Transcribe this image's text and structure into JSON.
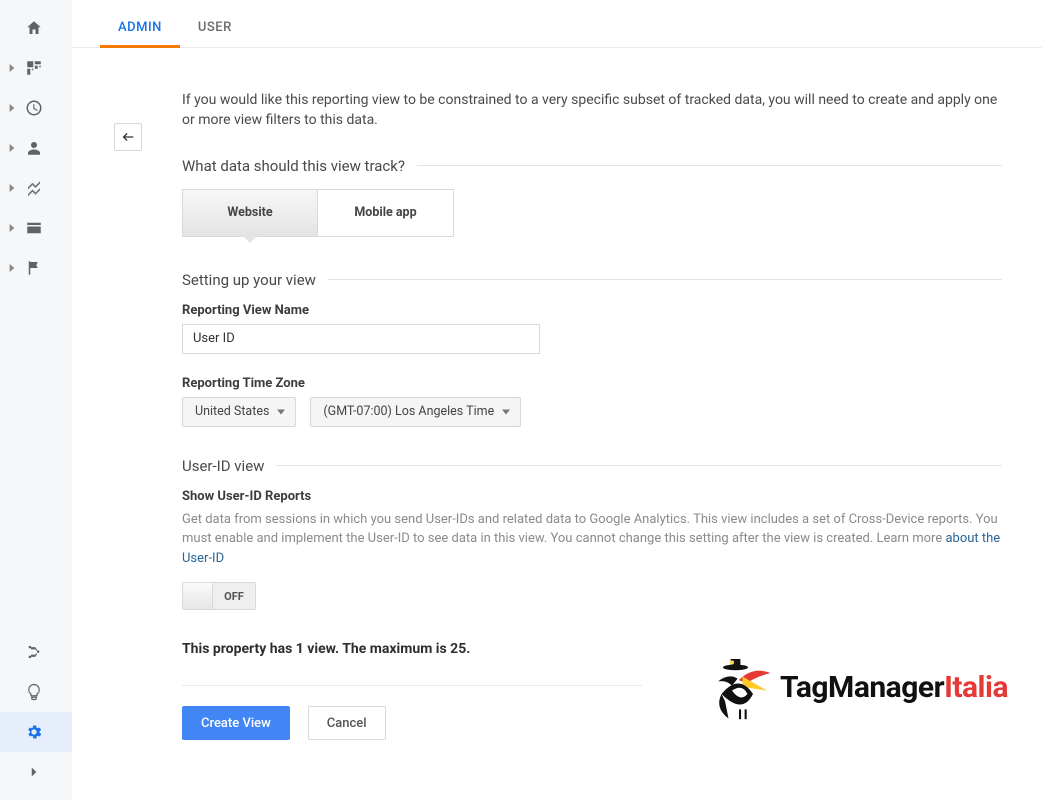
{
  "tabs": {
    "admin": "ADMIN",
    "user": "USER"
  },
  "intro": "If you would like this reporting view to be constrained to a very specific subset of tracked data, you will need to create and apply one or more view filters to this data.",
  "section_track": {
    "title": "What data should this view track?",
    "website": "Website",
    "mobile": "Mobile app"
  },
  "section_setup": {
    "title": "Setting up your view",
    "name_label": "Reporting View Name",
    "name_value": "User ID",
    "tz_label": "Reporting Time Zone",
    "tz_country": "United States",
    "tz_value": "(GMT-07:00) Los Angeles Time"
  },
  "section_userid": {
    "title": "User-ID view",
    "show_label": "Show User-ID Reports",
    "description": "Get data from sessions in which you send User-IDs and related data to Google Analytics. This view includes a set of Cross-Device reports. You must enable and implement the User-ID to see data in this view. You cannot change this setting after the view is created. Learn more ",
    "link_text": "about the User-ID",
    "toggle_label": "OFF"
  },
  "property_count": "This property has 1 view. The maximum is 25.",
  "actions": {
    "create": "Create View",
    "cancel": "Cancel"
  },
  "brand": {
    "tm": "TagManager",
    "it": "Italia"
  }
}
